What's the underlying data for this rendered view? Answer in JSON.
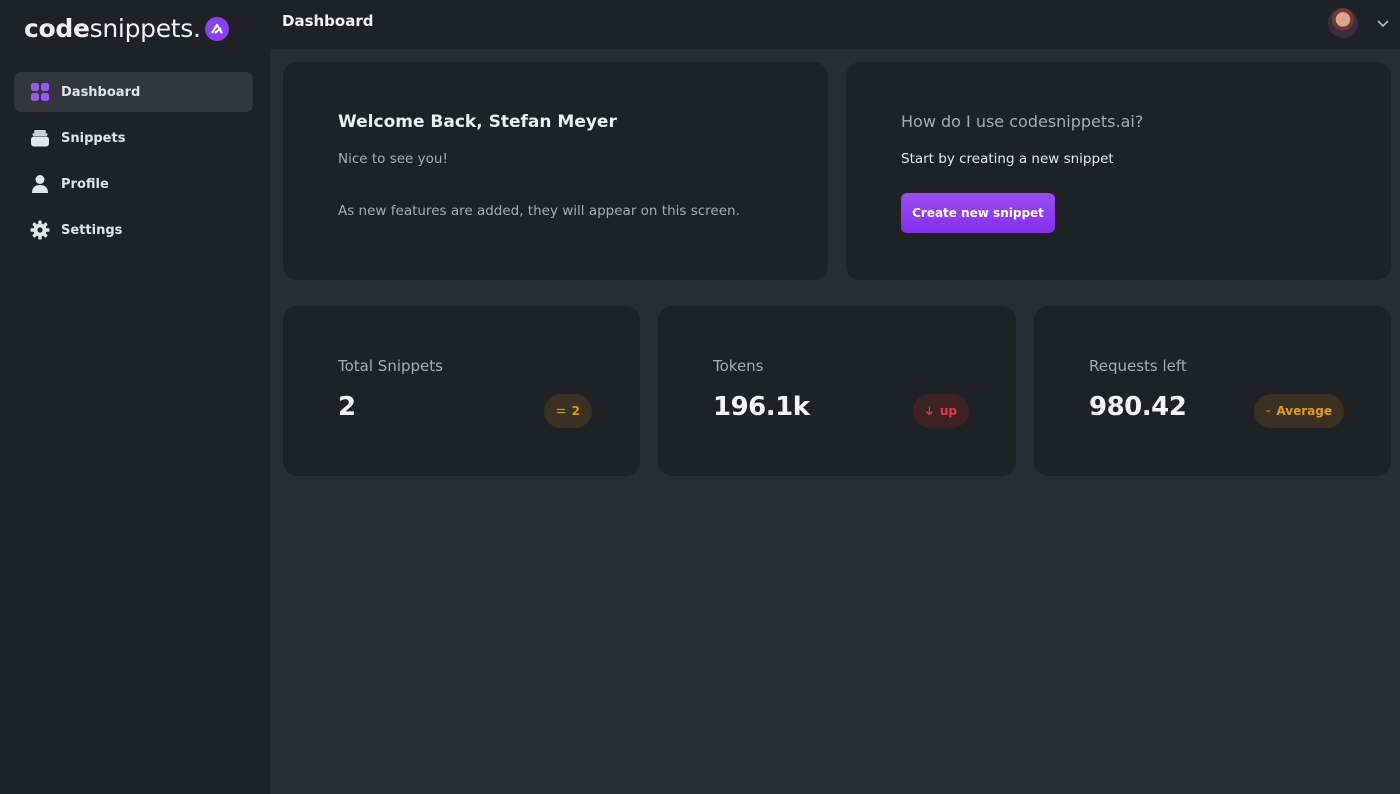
{
  "app": {
    "logo_bold": "code",
    "logo_light": "snippets.",
    "accent": "#8b3ff2"
  },
  "sidebar": {
    "items": [
      {
        "label": "Dashboard",
        "icon": "grid-icon",
        "active": true
      },
      {
        "label": "Snippets",
        "icon": "stack-icon",
        "active": false
      },
      {
        "label": "Profile",
        "icon": "user-icon",
        "active": false
      },
      {
        "label": "Settings",
        "icon": "gear-icon",
        "active": false
      }
    ]
  },
  "header": {
    "title": "Dashboard"
  },
  "welcome": {
    "title": "Welcome Back, Stefan Meyer",
    "subtitle": "Nice to see you!",
    "note": "As new features are added, they will appear on this screen."
  },
  "howto": {
    "title": "How do I use codesnippets.ai?",
    "text": "Start by creating a new snippet",
    "button_label": "Create new snippet"
  },
  "stats": [
    {
      "label": "Total Snippets",
      "value": "2",
      "badge": "2",
      "badge_kind": "neutral",
      "badge_icon": "equals-icon"
    },
    {
      "label": "Tokens",
      "value": "196.1k",
      "badge": "up",
      "badge_kind": "down",
      "badge_icon": "arrow-down-icon"
    },
    {
      "label": "Requests left",
      "value": "980.42",
      "badge": "Average",
      "badge_kind": "neutral",
      "badge_icon": "equals-icon"
    }
  ],
  "colors": {
    "neutral_badge": "#e39a20",
    "down_badge": "#e23b43"
  }
}
